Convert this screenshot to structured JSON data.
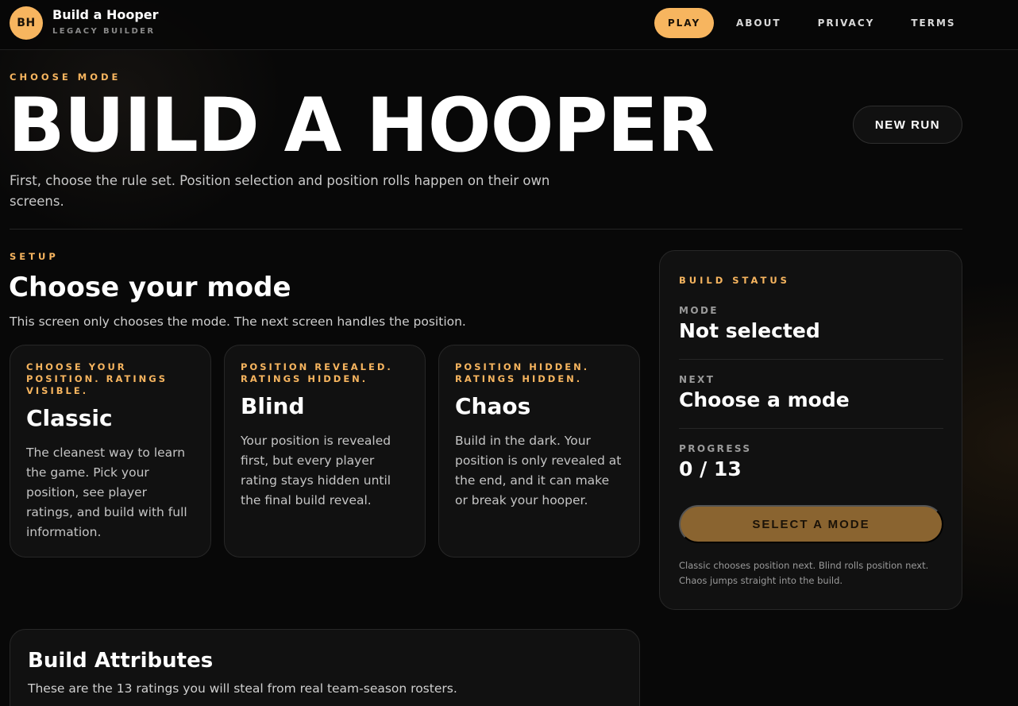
{
  "nav": {
    "logo_initials": "BH",
    "brand_title": "Build a Hooper",
    "brand_subtitle": "LEGACY BUILDER",
    "links": [
      {
        "label": "PLAY",
        "active": true
      },
      {
        "label": "ABOUT",
        "active": false
      },
      {
        "label": "PRIVACY",
        "active": false
      },
      {
        "label": "TERMS",
        "active": false
      }
    ]
  },
  "hero": {
    "eyebrow": "CHOOSE MODE",
    "title": "BUILD A HOOPER",
    "description": "First, choose the rule set. Position selection and position rolls happen on their own screens.",
    "new_run_label": "NEW RUN"
  },
  "setup": {
    "eyebrow": "SETUP",
    "title": "Choose your mode",
    "description": "This screen only chooses the mode. The next screen handles the position.",
    "modes": [
      {
        "tag": "CHOOSE YOUR POSITION. RATINGS VISIBLE.",
        "name": "Classic",
        "body": "The cleanest way to learn the game. Pick your position, see player ratings, and build with full information."
      },
      {
        "tag": "POSITION REVEALED. RATINGS HIDDEN.",
        "name": "Blind",
        "body": "Your position is revealed first, but every player rating stays hidden until the final build reveal."
      },
      {
        "tag": "POSITION HIDDEN. RATINGS HIDDEN.",
        "name": "Chaos",
        "body": "Build in the dark. Your position is only revealed at the end, and it can make or break your hooper."
      }
    ]
  },
  "status": {
    "eyebrow": "BUILD STATUS",
    "mode_label": "MODE",
    "mode_value": "Not selected",
    "next_label": "NEXT",
    "next_value": "Choose a mode",
    "progress_label": "PROGRESS",
    "progress_value": "0 / 13",
    "button_label": "SELECT A MODE",
    "note": "Classic chooses position next. Blind rolls position next. Chaos jumps straight into the build."
  },
  "attributes": {
    "title": "Build Attributes",
    "description": "These are the 13 ratings you will steal from real team-season rosters."
  },
  "colors": {
    "accent": "#f7b55f",
    "button_muted": "#8a6430",
    "background": "#080808",
    "card": "#111111"
  }
}
